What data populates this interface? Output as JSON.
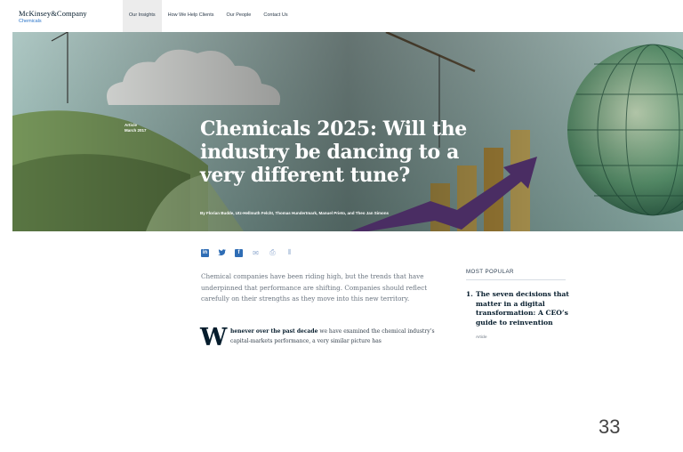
{
  "header": {
    "logo_name": "McKinsey&Company",
    "logo_sub": "Chemicals",
    "nav": [
      {
        "label": "Our Insights",
        "active": true
      },
      {
        "label": "How We Help Clients",
        "active": false
      },
      {
        "label": "Our People",
        "active": false
      },
      {
        "label": "Contact Us",
        "active": false
      }
    ]
  },
  "hero": {
    "type": "Article",
    "date": "March 2017",
    "title": "Chemicals 2025: Will the industry be dancing to a very different tune?",
    "authors": "By Florian Budde, Utz-Hellmuth Felcht, Thomas Hundertmark, Manuel Prieto, and Theo Jan Simons"
  },
  "share": [
    {
      "name": "linkedin-icon",
      "glyph": "in"
    },
    {
      "name": "twitter-icon",
      "glyph": "🐦"
    },
    {
      "name": "facebook-icon",
      "glyph": "f"
    },
    {
      "name": "email-icon",
      "glyph": "✉"
    },
    {
      "name": "print-icon",
      "glyph": "⎙"
    },
    {
      "name": "save-icon",
      "glyph": "⫴"
    }
  ],
  "article": {
    "intro": "Chemical companies have been riding high, but the trends that have underpinned that performance are shifting. Companies should reflect carefully on their strengths as they move into this new territory.",
    "dropcap": "W",
    "lead_bold": "henever over the past decade",
    "lead_rest": " we have examined the chemical industry’s capital-markets performance, a very similar picture has"
  },
  "sidebar": {
    "heading": "MOST POPULAR",
    "items": [
      {
        "num": "1.",
        "title": "The seven decisions that matter in a digital transformation: A CEO’s guide to reinvention",
        "type": "Article"
      }
    ]
  },
  "page_number": "33",
  "colors": {
    "brand_navy": "#051c2c",
    "link_blue": "#2f6db5",
    "hero_sky": "#a9c7c2",
    "arrow_purple": "#4a2d63"
  }
}
